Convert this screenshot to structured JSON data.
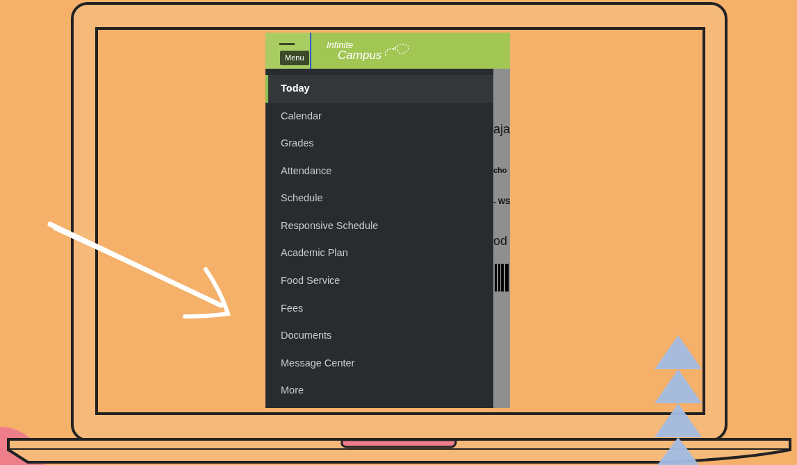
{
  "header": {
    "menu_tooltip": "Menu",
    "logo_top": "Infinite",
    "logo_bottom": "Campus"
  },
  "menu": {
    "items": [
      {
        "label": "Today",
        "selected": true
      },
      {
        "label": "Calendar",
        "selected": false
      },
      {
        "label": "Grades",
        "selected": false
      },
      {
        "label": "Attendance",
        "selected": false
      },
      {
        "label": "Schedule",
        "selected": false
      },
      {
        "label": "Responsive Schedule",
        "selected": false
      },
      {
        "label": "Academic Plan",
        "selected": false
      },
      {
        "label": "Food Service",
        "selected": false
      },
      {
        "label": "Fees",
        "selected": false
      },
      {
        "label": "Documents",
        "selected": false
      },
      {
        "label": "Message Center",
        "selected": false
      },
      {
        "label": "More",
        "selected": false
      }
    ]
  },
  "page_behind": {
    "fragments": [
      {
        "text": "aja",
        "kind": "large"
      },
      {
        "text": "cho",
        "kind": "bold"
      },
      {
        "text": "- WS",
        "kind": "bold"
      },
      {
        "text": "od",
        "kind": "large"
      },
      {
        "kind": "barcode"
      }
    ]
  }
}
